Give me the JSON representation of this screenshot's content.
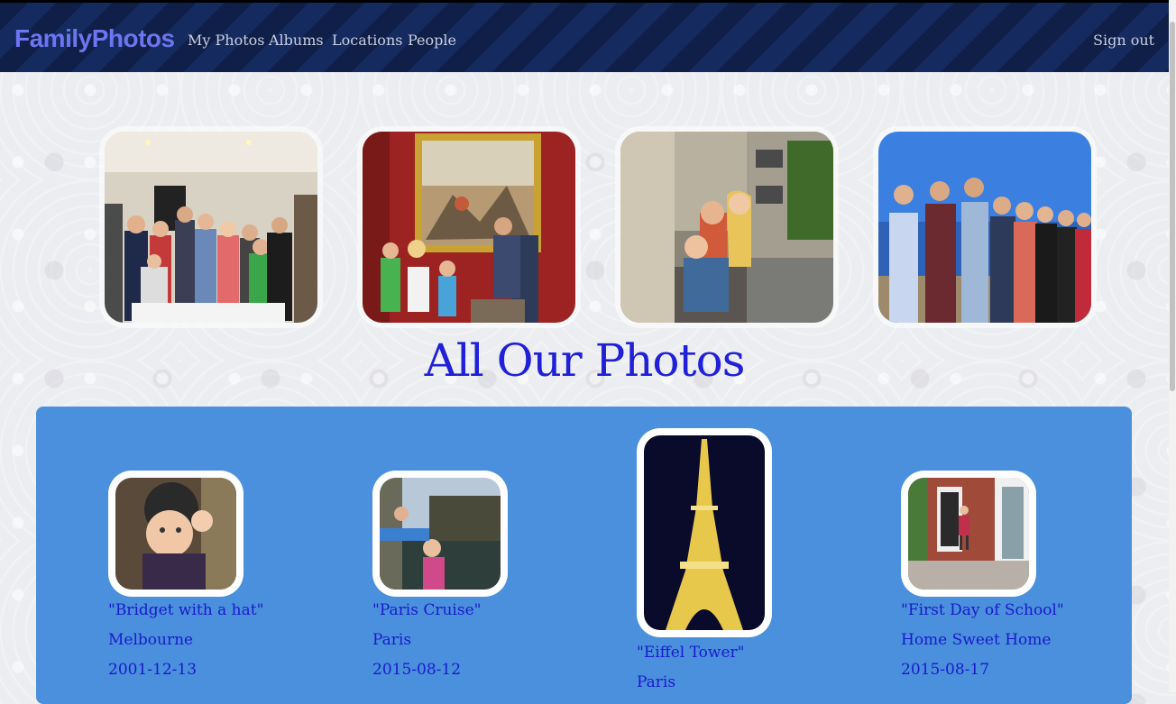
{
  "navbar": {
    "brand": "FamilyPhotos",
    "links": [
      "My Photos",
      "Albums",
      "Locations",
      "People"
    ],
    "sign_out": "Sign out"
  },
  "hero_photos": [
    {
      "subject": "group-indoor"
    },
    {
      "subject": "painting-museum"
    },
    {
      "subject": "street-balcony"
    },
    {
      "subject": "group-outdoor"
    }
  ],
  "page": {
    "heading": "All Our Photos"
  },
  "gallery": [
    {
      "title": "\"Bridget with a hat\"",
      "location": "Melbourne",
      "date": "2001-12-13"
    },
    {
      "title": "\"Paris Cruise\"",
      "location": "Paris",
      "date": "2015-08-12"
    },
    {
      "title": "\"Eiffel Tower\"",
      "location": "Paris",
      "date": ""
    },
    {
      "title": "\"First Day of School\"",
      "location": "Home Sweet Home",
      "date": "2015-08-17"
    }
  ],
  "colors": {
    "navbar": "#0f1f48",
    "brand": "#6d75f0",
    "heading": "#2020d8",
    "gallery_bg": "#4a90dc",
    "caption": "#1a1acc"
  }
}
